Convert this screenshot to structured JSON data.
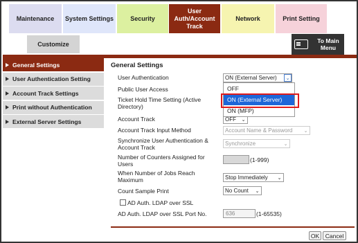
{
  "tabs": {
    "maintenance": "Maintenance",
    "system_settings": "System Settings",
    "security": "Security",
    "user_auth": "User Auth/Account Track",
    "network": "Network",
    "print_setting": "Print Setting",
    "customize": "Customize",
    "to_main_menu": "To Main Menu"
  },
  "sidebar": {
    "items": [
      {
        "label": "General Settings",
        "active": true
      },
      {
        "label": "User Authentication Setting",
        "active": false
      },
      {
        "label": "Account Track Settings",
        "active": false
      },
      {
        "label": "Print without Authentication",
        "active": false
      },
      {
        "label": "External Server Settings",
        "active": false
      }
    ]
  },
  "main": {
    "section_title": "General Settings",
    "user_authentication": {
      "label": "User Authentication",
      "value": "ON (External Server)"
    },
    "public_user_access": {
      "label": "Public User Access"
    },
    "ticket_hold_time": {
      "label": "Ticket Hold Time Setting (Active Directory)"
    },
    "account_track": {
      "label": "Account Track",
      "value": "OFF"
    },
    "account_track_input": {
      "label": "Account Track Input Method",
      "value": "Account Name & Password"
    },
    "sync_user_auth": {
      "label": "Synchronize User Authentication & Account Track",
      "value": "Synchronize"
    },
    "counters_assigned": {
      "label": "Number of Counters Assigned for Users",
      "hint": "(1-999)"
    },
    "jobs_reach_max": {
      "label": "When Number of Jobs Reach Maximum",
      "value": "Stop Immediately"
    },
    "count_sample_print": {
      "label": "Count Sample Print",
      "value": "No Count"
    },
    "ad_ldap_ssl": {
      "label": "AD Auth. LDAP over SSL",
      "checked": false
    },
    "ad_ldap_port": {
      "label": "AD Auth. LDAP over SSL Port No.",
      "value": "636",
      "hint": "(1-65535)"
    }
  },
  "dropdown": {
    "options": [
      "OFF",
      "ON (External Server)",
      "ON (MFP)"
    ],
    "selected": "ON (External Server)"
  },
  "buttons": {
    "ok": "OK",
    "cancel": "Cancel"
  },
  "colors": {
    "accent": "#8b2a12",
    "highlight_border": "#e01a1a",
    "selection": "#1e66d8"
  }
}
